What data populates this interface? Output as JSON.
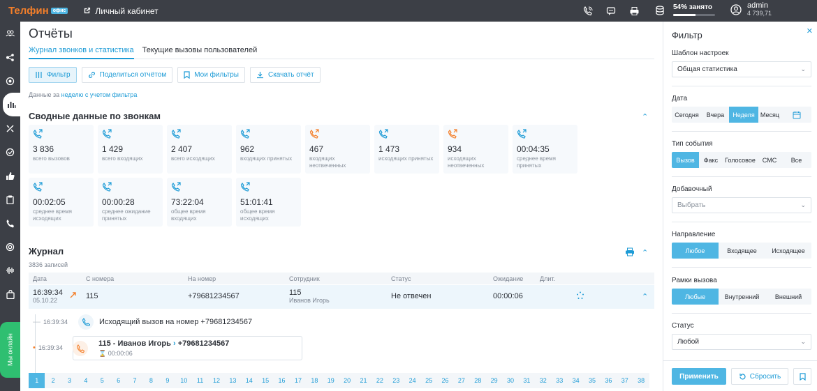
{
  "topbar": {
    "logo": "Телфин",
    "logo_badge": "офис",
    "cabinet": "Личный кабинет",
    "icons": [
      "call-icon",
      "chat-icon",
      "fax-icon"
    ],
    "storage_label": "54% занято",
    "storage_percent": 54,
    "user_name": "admin",
    "user_balance": "4 739,71"
  },
  "sidebar": {
    "items": [
      "contacts-icon",
      "network-icon",
      "settings-icon",
      "stats-icon",
      "tools-icon",
      "check-icon",
      "like-icon",
      "clipboard-icon",
      "phone-icon",
      "support-icon",
      "voice-icon",
      "bag-icon"
    ],
    "online_label": "Мы онлайн"
  },
  "page": {
    "title": "Отчёты",
    "tabs": [
      "Журнал звонков и статистика",
      "Текущие вызовы пользователей"
    ],
    "buttons": {
      "filter": "Фильтр",
      "share": "Поделиться отчётом",
      "my_filters": "Мои фильтры",
      "download": "Скачать отчёт"
    },
    "period_prefix": "Данные за",
    "period_link": "неделю с учетом фильтра"
  },
  "summary": {
    "title": "Сводные данные по звонкам",
    "cards": [
      {
        "value": "3 836",
        "label": "всего вызовов",
        "color": "#1d9bd6"
      },
      {
        "value": "1 429",
        "label": "всего входящих",
        "color": "#1d9bd6"
      },
      {
        "value": "2 407",
        "label": "всего исходящих",
        "color": "#1d9bd6"
      },
      {
        "value": "962",
        "label": "входящих принятых",
        "color": "#1d9bd6"
      },
      {
        "value": "467",
        "label": "входящих неотвеченных",
        "color": "#f47f2a"
      },
      {
        "value": "1 473",
        "label": "исходящих принятых",
        "color": "#1d9bd6"
      },
      {
        "value": "934",
        "label": "исходящих неотвеченных",
        "color": "#f47f2a"
      },
      {
        "value": "00:04:35",
        "label": "среднее время принятых",
        "color": "#1d9bd6"
      },
      {
        "value": "00:02:05",
        "label": "среднее время исходящих",
        "color": "#1d9bd6"
      },
      {
        "value": "00:00:28",
        "label": "среднее ожидание принятых",
        "color": "#1d9bd6"
      },
      {
        "value": "73:22:04",
        "label": "общее время входящих",
        "color": "#1d9bd6"
      },
      {
        "value": "51:01:41",
        "label": "общее время исходящих",
        "color": "#1d9bd6"
      }
    ]
  },
  "journal": {
    "title": "Журнал",
    "records": "3836 записей",
    "columns": [
      "Дата",
      "С номера",
      "На номер",
      "Сотрудник",
      "Статус",
      "Ожидание",
      "Длит."
    ],
    "row": {
      "time": "16:39:34",
      "date": "05.10.22",
      "from": "115",
      "to": "+79681234567",
      "employee_ext": "115",
      "employee_name": "Иванов Игорь",
      "status": "Не отвечен",
      "wait": "00:00:06"
    },
    "events": [
      {
        "time": "16:39:34",
        "text": "Исходящий вызов на номер +79681234567"
      },
      {
        "time": "16:39:34",
        "title": "115 - Иванов Игорь",
        "arrow": "›",
        "target": "+79681234567",
        "wait": "00:00:06"
      }
    ],
    "pages": [
      "1",
      "2",
      "3",
      "4",
      "5",
      "6",
      "7",
      "8",
      "9",
      "10",
      "11",
      "12",
      "13",
      "14",
      "15",
      "16",
      "17",
      "18",
      "19",
      "20",
      "21",
      "22",
      "23",
      "24",
      "25",
      "26",
      "27",
      "28",
      "29",
      "30",
      "31",
      "32",
      "33",
      "34",
      "35",
      "36",
      "37",
      "38"
    ]
  },
  "filter": {
    "title": "Фильтр",
    "template_label": "Шаблон настроек",
    "template_value": "Общая статистика",
    "date_label": "Дата",
    "date_options": [
      "Сегодня",
      "Вчера",
      "Неделя",
      "Месяц"
    ],
    "date_selected": "Неделя",
    "event_label": "Тип события",
    "event_options": [
      "Вызов",
      "Факс",
      "Голосовое",
      "СМС",
      "Все"
    ],
    "event_selected": "Вызов",
    "ext_label": "Добавочный",
    "ext_placeholder": "Выбрать",
    "direction_label": "Направление",
    "direction_options": [
      "Любое",
      "Входящее",
      "Исходящее"
    ],
    "direction_selected": "Любое",
    "scope_label": "Рамки вызова",
    "scope_options": [
      "Любые",
      "Внутренний",
      "Внешний"
    ],
    "scope_selected": "Любые",
    "status_label": "Статус",
    "status_value": "Любой",
    "apply": "Применить",
    "reset": "Сбросить"
  }
}
